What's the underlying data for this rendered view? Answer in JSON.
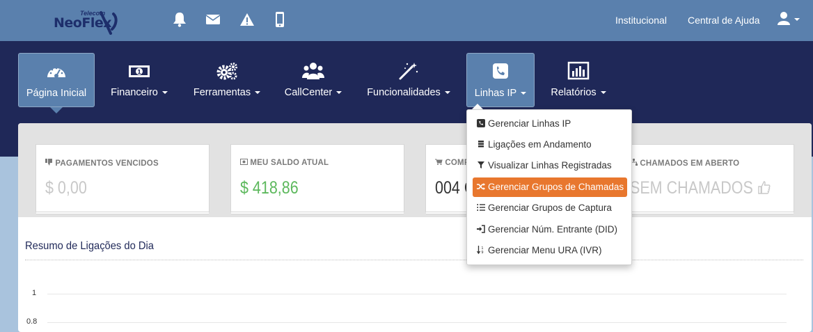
{
  "topbar": {
    "logo": {
      "word": "NeoFlex",
      "sub": "Telecom"
    },
    "icons": [
      "bell-icon",
      "envelope-icon",
      "warning-icon",
      "mobile-icon"
    ],
    "links": [
      "Institucional",
      "Central de Ajuda"
    ],
    "user_icon": "user-icon"
  },
  "nav": {
    "items": [
      {
        "label": "Página Inicial",
        "icon": "dashboard-icon",
        "active": true,
        "caret": false
      },
      {
        "label": "Financeiro",
        "icon": "money-icon",
        "active": false,
        "caret": true
      },
      {
        "label": "Ferramentas",
        "icon": "cogs-icon",
        "active": false,
        "caret": true
      },
      {
        "label": "CallCenter",
        "icon": "users-icon",
        "active": false,
        "caret": true
      },
      {
        "label": "Funcionalidades",
        "icon": "magic-wand-icon",
        "active": false,
        "caret": true
      },
      {
        "label": "Linhas IP",
        "icon": "phone-icon",
        "active": true,
        "caret": true
      },
      {
        "label": "Relatórios",
        "icon": "bar-chart-icon",
        "active": false,
        "caret": true
      }
    ]
  },
  "cards": [
    {
      "title": "PAGAMENTOS VENCIDOS",
      "value": "$ 0,00",
      "color": "#c8c8c8",
      "icon": "thumbs-down-icon"
    },
    {
      "title": "MEU SALDO ATUAL",
      "value": "$ 418,86",
      "color": "#5cb85c",
      "icon": "money-icon"
    },
    {
      "title": "COMP",
      "value": "004 C",
      "color": "#333333",
      "icon": "cart-icon"
    },
    {
      "title": "CHAMADOS EM ABERTO",
      "value": "SEM CHAMADOS",
      "color": "#c8c8c8",
      "icon": "sitemap-icon"
    }
  ],
  "section": {
    "title": "Resumo de Ligações do Dia"
  },
  "chart_axis": {
    "y_ticks": [
      "1",
      "0.8"
    ]
  },
  "dropdown": {
    "items": [
      {
        "label": "Gerenciar Linhas IP",
        "icon": "phone-square-icon",
        "highlight": false
      },
      {
        "label": "Ligações em Andamento",
        "icon": "database-icon",
        "highlight": false
      },
      {
        "label": "Visualizar Linhas Registradas",
        "icon": "filter-icon",
        "highlight": false
      },
      {
        "label": "Gerenciar Grupos de Chamadas",
        "icon": "random-icon",
        "highlight": true
      },
      {
        "label": "Gerenciar Grupos de Captura",
        "icon": "list-ol-icon",
        "highlight": false
      },
      {
        "label": "Gerenciar Núm. Entrante (DID)",
        "icon": "sign-in-icon",
        "highlight": false
      },
      {
        "label": "Gerenciar Menu URA (IVR)",
        "icon": "sort-numeric-icon",
        "highlight": false
      }
    ]
  },
  "colors": {
    "topbar": "#5a80ad",
    "nav": "#1f2858",
    "accent": "#e8772e",
    "green": "#5cb85c"
  }
}
